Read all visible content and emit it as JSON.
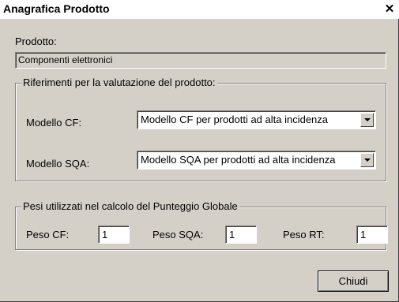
{
  "window": {
    "title": "Anagrafica Prodotto",
    "close_glyph": "✕"
  },
  "product": {
    "label": "Prodotto:",
    "value": "Componenti elettronici"
  },
  "evaluation": {
    "legend": "Riferimenti per la valutazione del prodotto:",
    "cf_label": "Modello CF:",
    "cf_value": "Modello CF per prodotti ad alta incidenza",
    "sqa_label": "Modello SQA:",
    "sqa_value": "Modello SQA per prodotti ad alta incidenza"
  },
  "weights": {
    "legend": "Pesi utilizzati nel calcolo del Punteggio Globale",
    "cf_label": "Peso CF:",
    "cf_value": "1",
    "sqa_label": "Peso SQA:",
    "sqa_value": "1",
    "rt_label": "Peso RT:",
    "rt_value": "1"
  },
  "buttons": {
    "close_label": "Chiudi"
  },
  "icons": {
    "close": "close-icon",
    "dropdown": "chevron-down-icon"
  },
  "colors": {
    "face": "#d4d0c8",
    "field": "#ffffff"
  }
}
